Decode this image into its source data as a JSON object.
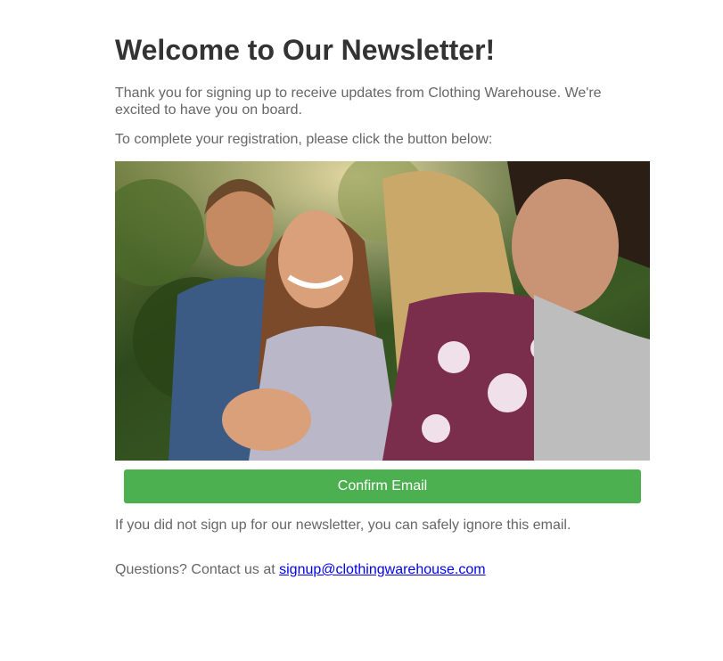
{
  "email": {
    "title": "Welcome to Our Newsletter!",
    "intro": "Thank you for signing up to receive updates from Clothing Warehouse. We're excited to have you on board.",
    "instruction": "To complete your registration, please click the button below:",
    "hero_image_alt": "Group of friends laughing outdoors",
    "confirm_button": "Confirm Email",
    "ignore_notice": "If you did not sign up for our newsletter, you can safely ignore this email.",
    "contact_prefix": "Questions? Contact us at ",
    "contact_email": "signup@clothingwarehouse.com",
    "contact_href": "mailto:signup@clothingwarehouse.com"
  },
  "colors": {
    "button": "#4caf50",
    "heading": "#333333",
    "body_text": "#666666",
    "link": "#0000ee"
  }
}
